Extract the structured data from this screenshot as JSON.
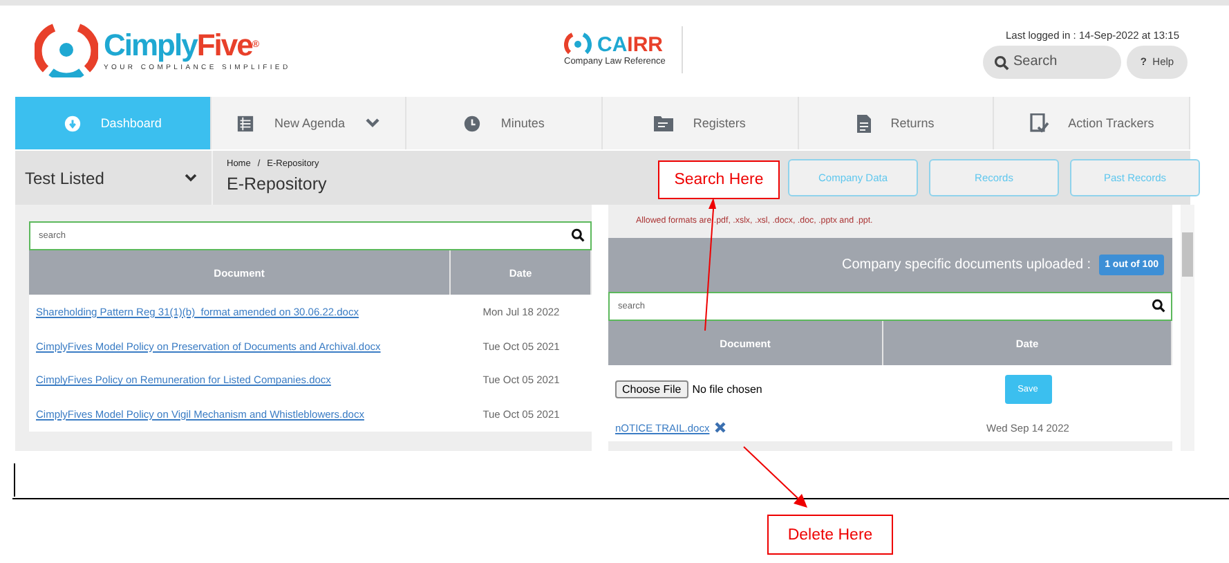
{
  "header": {
    "logo": {
      "first": "Cimply",
      "second": "Five",
      "mark": "®",
      "tagline": "YOUR COMPLIANCE SIMPLIFIED"
    },
    "cairr": {
      "first": "CA",
      "second": "IRR",
      "subtitle": "Company Law Reference"
    },
    "last_login": "Last logged in : 14-Sep-2022 at 13:15",
    "search": {
      "placeholder": "Search"
    },
    "help": {
      "icon": "?",
      "label": "Help"
    }
  },
  "nav": [
    {
      "label": "Dashboard",
      "selected": true,
      "dropdown": false,
      "kind": "dashboard"
    },
    {
      "label": "New Agenda",
      "selected": false,
      "dropdown": true,
      "kind": "agenda"
    },
    {
      "label": "Minutes",
      "selected": false,
      "dropdown": false,
      "kind": "clock"
    },
    {
      "label": "Registers",
      "selected": false,
      "dropdown": false,
      "kind": "folder"
    },
    {
      "label": "Returns",
      "selected": false,
      "dropdown": false,
      "kind": "file"
    },
    {
      "label": "Action Trackers",
      "selected": false,
      "dropdown": false,
      "kind": "tracker"
    }
  ],
  "company_selector": "Test Listed",
  "breadcrumb": {
    "items": [
      "Home",
      "E-Repository"
    ],
    "separator": "/"
  },
  "page_title": "E-Repository",
  "action_buttons": [
    "Company Data",
    "Records",
    "Past Records"
  ],
  "left_table": {
    "search": {
      "placeholder": "search"
    },
    "columns": [
      "Document",
      "Date"
    ],
    "rows": [
      {
        "document": "Shareholding Pattern Reg 31(1)(b)_format amended on 30.06.22.docx",
        "date": "Mon Jul 18 2022"
      },
      {
        "document": "CimplyFives Model Policy on Preservation of Documents and Archival.docx",
        "date": "Tue Oct 05 2021"
      },
      {
        "document": "CimplyFives Policy on Remuneration for Listed Companies.docx",
        "date": "Tue Oct 05 2021"
      },
      {
        "document": "CimplyFives Model Policy on Vigil Mechanism and Whistleblowers.docx",
        "date": "Tue Oct 05 2021"
      }
    ]
  },
  "right_panel": {
    "notice": "Allowed formats are .pdf, .xslx, .xsl, .docx, .doc, .pptx and .ppt.",
    "uploaded_label": "Company specific documents uploaded :",
    "uploaded_badge": "1 out of 100",
    "search": {
      "placeholder": "search"
    },
    "columns": [
      "Document",
      "Date"
    ],
    "file_input": {
      "button": "Choose File",
      "status": "No file chosen"
    },
    "save": "Save",
    "rows": [
      {
        "document": "nOTICE TRAIL.docx",
        "date": "Wed Sep 14 2022"
      }
    ]
  },
  "annotations": [
    {
      "text": "Search Here"
    },
    {
      "text": "Delete Here"
    }
  ]
}
